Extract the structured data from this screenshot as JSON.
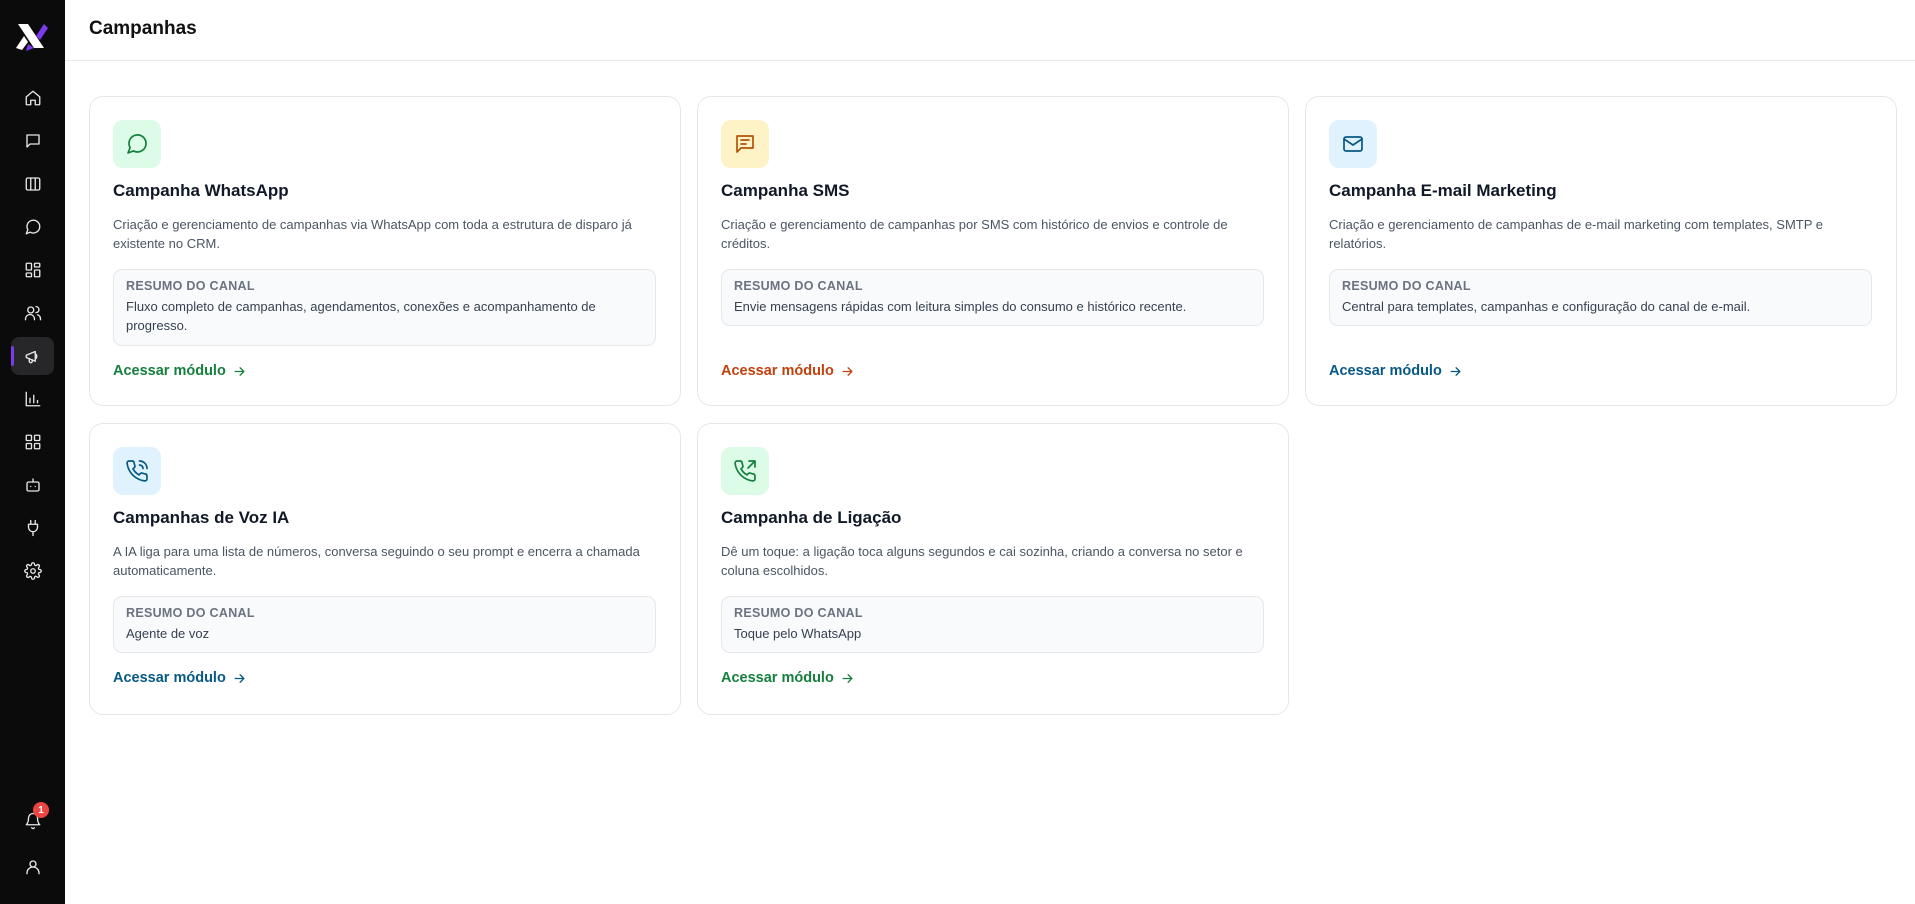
{
  "app": {
    "title": "Campanhas"
  },
  "sidebar": {
    "items": [
      {
        "icon": "home-icon"
      },
      {
        "icon": "message-square-icon"
      },
      {
        "icon": "kanban-icon"
      },
      {
        "icon": "message-circle-icon"
      },
      {
        "icon": "dashboard-icon"
      },
      {
        "icon": "users-icon"
      },
      {
        "icon": "megaphone-icon",
        "active": true
      },
      {
        "icon": "bar-chart-icon"
      },
      {
        "icon": "apps-grid-icon"
      },
      {
        "icon": "bot-icon"
      },
      {
        "icon": "plug-icon"
      },
      {
        "icon": "settings-icon"
      }
    ],
    "notifications_count": "1",
    "active_color": "#7c3aed"
  },
  "cards": [
    {
      "title": "Campanha WhatsApp",
      "description": "Criação e gerenciamento de campanhas via WhatsApp com toda a estrutura de disparo já existente no CRM.",
      "summary_label": "RESUMO DO CANAL",
      "summary_text": "Fluxo completo de campanhas, agendamentos, conexões e acompanhamento de progresso.",
      "link": "Acessar módulo",
      "icon": "message-circle-icon",
      "accent": "#15803d",
      "icon_bg": "#dcfce7"
    },
    {
      "title": "Campanha SMS",
      "description": "Criação e gerenciamento de campanhas por SMS com histórico de envios e controle de créditos.",
      "summary_label": "RESUMO DO CANAL",
      "summary_text": "Envie mensagens rápidas com leitura simples do consumo e histórico recente.",
      "link": "Acessar módulo",
      "icon": "message-text-icon",
      "accent": "#c2410c",
      "icon_bg": "#fef3c7"
    },
    {
      "title": "Campanha E-mail Marketing",
      "description": "Criação e gerenciamento de campanhas de e-mail marketing com templates, SMTP e relatórios.",
      "summary_label": "RESUMO DO CANAL",
      "summary_text": "Central para templates, campanhas e configuração do canal de e-mail.",
      "link": "Acessar módulo",
      "icon": "mail-icon",
      "accent": "#075985",
      "icon_bg": "#e0f2fe"
    },
    {
      "title": "Campanhas de Voz IA",
      "description": "A IA liga para uma lista de números, conversa seguindo o seu prompt e encerra a chamada automaticamente.",
      "summary_label": "RESUMO DO CANAL",
      "summary_text": "Agente de voz",
      "link": "Acessar módulo",
      "icon": "phone-call-icon",
      "accent": "#075985",
      "icon_bg": "#e0f2fe"
    },
    {
      "title": "Campanha de Ligação",
      "description": "Dê um toque: a ligação toca alguns segundos e cai sozinha, criando a conversa no setor e coluna escolhidos.",
      "summary_label": "RESUMO DO CANAL",
      "summary_text": "Toque pelo WhatsApp",
      "link": "Acessar módulo",
      "icon": "phone-outgoing-icon",
      "accent": "#15803d",
      "icon_bg": "#dcfce7"
    }
  ]
}
